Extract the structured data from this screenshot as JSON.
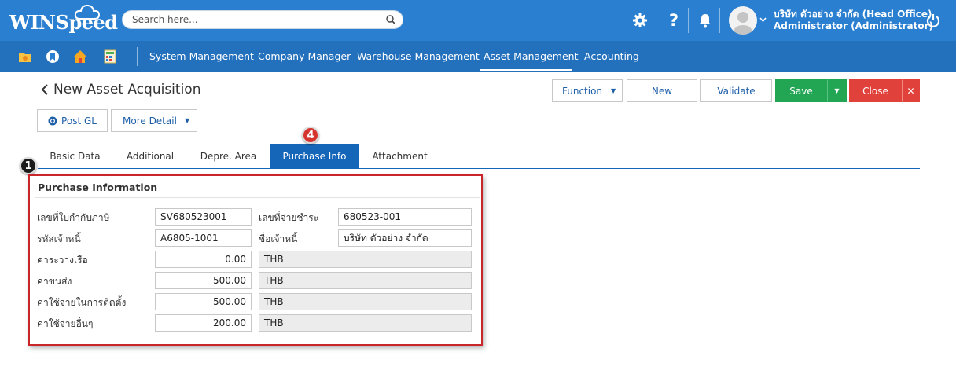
{
  "header": {
    "logo_text": "WINSpeed",
    "search_placeholder": "Search here...",
    "user_company": "บริษัท ตัวอย่าง จำกัด (Head Office)",
    "user_name": "Administrator (Administrator)",
    "icons": [
      "gear-icon",
      "help-icon",
      "bell-icon",
      "avatar",
      "chevron-down-icon",
      "power-icon"
    ],
    "colors": {
      "topbar": "#2a7fd0",
      "navbar": "#2370bd"
    }
  },
  "nav": {
    "items": [
      "System Management",
      "Company Manager",
      "Warehouse Management",
      "Asset Management",
      "Accounting"
    ],
    "active": "Asset Management",
    "quick_icons": [
      "folder-icon",
      "bookmark-icon",
      "home-icon",
      "calculator-icon"
    ]
  },
  "page": {
    "title": "New Asset Acquisition"
  },
  "toolbar": {
    "function": "Function",
    "new": "New",
    "validate": "Validate",
    "save": "Save",
    "close": "Close",
    "post_gl": "Post GL",
    "more_detail": "More Detail",
    "colors": {
      "save": "#22a654",
      "close": "#e0413a"
    }
  },
  "tabs": [
    {
      "label": "Basic Data"
    },
    {
      "label": "Additional"
    },
    {
      "label": "Depre. Area"
    },
    {
      "label": "Purchase Info"
    },
    {
      "label": "Attachment"
    }
  ],
  "active_tab": "Purchase Info",
  "badges": {
    "one": "1",
    "four": "4"
  },
  "purchase": {
    "heading": "Purchase Information",
    "rows": [
      {
        "label": "เลขที่ใบกำกับภาษี",
        "value": "SV680523001",
        "label2": "เลขที่จ่ายชำระ",
        "value2": "680523-001"
      },
      {
        "label": "รหัสเจ้าหนี้",
        "value": "A6805-1001",
        "label2": "ชื่อเจ้าหนี้",
        "value2": "บริษัท ตัวอย่าง จำกัด"
      },
      {
        "label": "ค่าระวางเรือ",
        "value": "0.00",
        "currency": "THB"
      },
      {
        "label": "ค่าขนส่ง",
        "value": "500.00",
        "currency": "THB"
      },
      {
        "label": "ค่าใช้จ่ายในการติดตั้ง",
        "value": "500.00",
        "currency": "THB"
      },
      {
        "label": "ค่าใช้จ่ายอื่นๆ",
        "value": "200.00",
        "currency": "THB"
      }
    ]
  }
}
